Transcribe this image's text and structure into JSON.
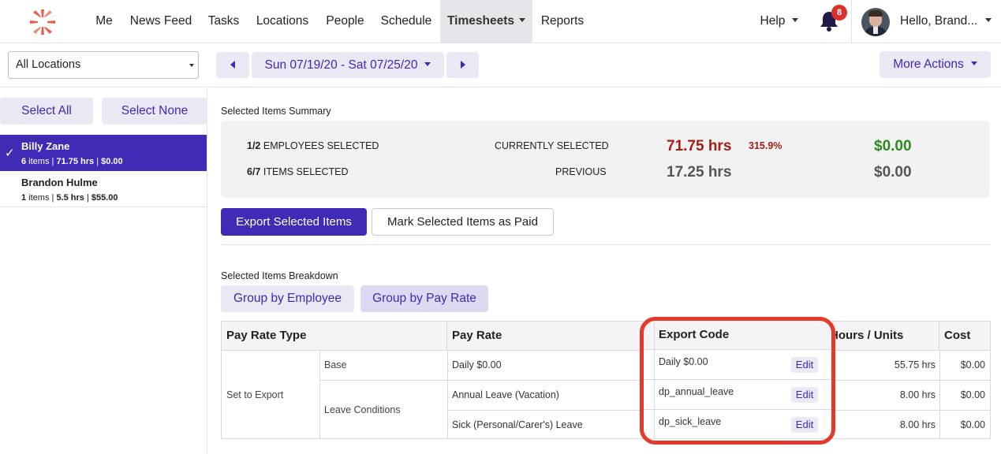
{
  "nav": {
    "items": [
      "Me",
      "News Feed",
      "Tasks",
      "Locations",
      "People",
      "Schedule",
      "Timesheets",
      "Reports"
    ],
    "active": "Timesheets",
    "help": "Help",
    "notification_count": "8",
    "user_greeting": "Hello, Brand..."
  },
  "toolbar": {
    "location": "All Locations",
    "date_range": "Sun 07/19/20 - Sat 07/25/20",
    "more_actions": "More Actions"
  },
  "sidebar": {
    "select_all": "Select All",
    "select_none": "Select None",
    "employees": [
      {
        "name": "Billy Zane",
        "items": "6",
        "hours": "71.75 hrs",
        "cost": "$0.00",
        "selected": true
      },
      {
        "name": "Brandon Hulme",
        "items": "1",
        "hours": "5.5 hrs",
        "cost": "$55.00",
        "selected": false
      }
    ]
  },
  "summary": {
    "title": "Selected Items Summary",
    "employees_selected_count": "1/2",
    "employees_selected_label": "EMPLOYEES SELECTED",
    "items_selected_count": "6/7",
    "items_selected_label": "ITEMS SELECTED",
    "current_label": "CURRENTLY SELECTED",
    "current_hours": "71.75 hrs",
    "current_percent": "315.9%",
    "current_cost": "$0.00",
    "previous_label": "PREVIOUS",
    "previous_hours": "17.25 hrs",
    "previous_cost": "$0.00"
  },
  "actions": {
    "export": "Export Selected Items",
    "mark_paid": "Mark Selected Items as Paid"
  },
  "breakdown": {
    "title": "Selected Items Breakdown",
    "group_by_employee": "Group by Employee",
    "group_by_pay_rate": "Group by Pay Rate",
    "columns": [
      "Pay Rate Type",
      "Pay Rate",
      "Export Code",
      "Hours / Units",
      "Cost"
    ],
    "group_label": "Set to Export",
    "sub_groups": [
      "Base",
      "Leave Conditions"
    ],
    "edit_label": "Edit",
    "rows": [
      {
        "pay_rate": "Daily $0.00",
        "export_code": "Daily $0.00",
        "hours": "55.75 hrs",
        "cost": "$0.00"
      },
      {
        "pay_rate": "Annual Leave (Vacation)",
        "export_code": "dp_annual_leave",
        "hours": "8.00 hrs",
        "cost": "$0.00"
      },
      {
        "pay_rate": "Sick (Personal/Carer's) Leave",
        "export_code": "dp_sick_leave",
        "hours": "8.00 hrs",
        "cost": "$0.00"
      }
    ]
  },
  "colors": {
    "primary": "#3f2bb6",
    "accent_text": "#3b2bb8",
    "current_hours": "#a81d12",
    "cost_green": "#2e8a1e",
    "previous_gray": "#555555",
    "highlight_red": "#e53a2b"
  }
}
